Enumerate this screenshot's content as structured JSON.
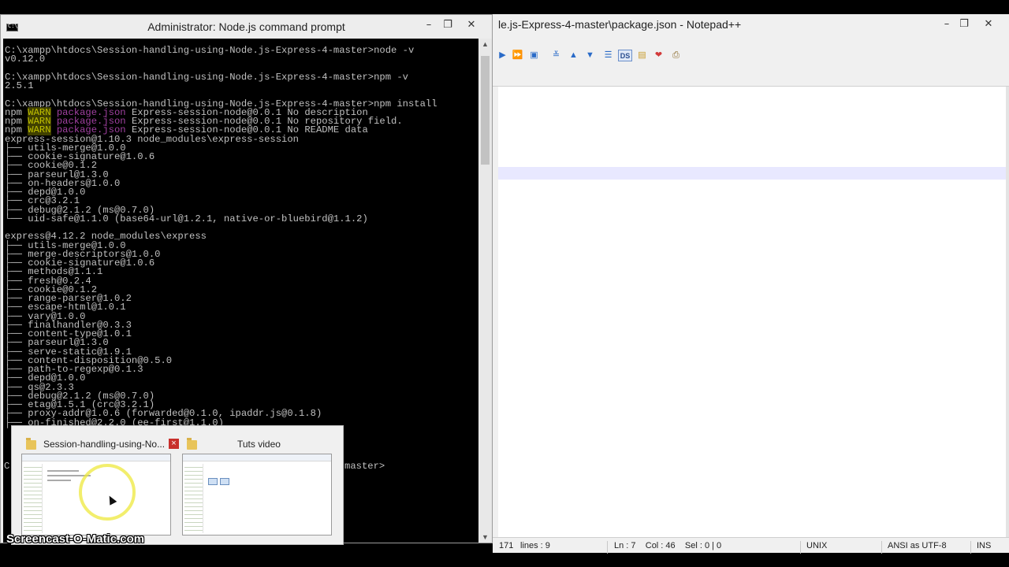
{
  "cmd": {
    "title": "Administrator: Node.js command prompt",
    "icon": "console-icon",
    "console_tail": "master>",
    "lines": [
      {
        "segments": [
          {
            "text": "C:\\xampp\\htdocs\\Session-handling-using-Node.js-Express-4-master>node -v"
          }
        ]
      },
      {
        "segments": [
          {
            "text": "v0.12.0"
          }
        ]
      },
      {
        "segments": [
          {
            "text": ""
          }
        ]
      },
      {
        "segments": [
          {
            "text": "C:\\xampp\\htdocs\\Session-handling-using-Node.js-Express-4-master>npm -v"
          }
        ]
      },
      {
        "segments": [
          {
            "text": "2.5.1"
          }
        ]
      },
      {
        "segments": [
          {
            "text": ""
          }
        ]
      },
      {
        "segments": [
          {
            "text": "C:\\xampp\\htdocs\\Session-handling-using-Node.js-Express-4-master>npm install"
          }
        ]
      },
      {
        "segments": [
          {
            "text": "npm "
          },
          {
            "text": "WARN",
            "style": "warn"
          },
          {
            "text": " "
          },
          {
            "text": "package.json",
            "style": "pkg"
          },
          {
            "text": " Express-session-node@0.0.1 No description"
          }
        ]
      },
      {
        "segments": [
          {
            "text": "npm "
          },
          {
            "text": "WARN",
            "style": "warn"
          },
          {
            "text": " "
          },
          {
            "text": "package.json",
            "style": "pkg"
          },
          {
            "text": " Express-session-node@0.0.1 No repository field."
          }
        ]
      },
      {
        "segments": [
          {
            "text": "npm "
          },
          {
            "text": "WARN",
            "style": "warn"
          },
          {
            "text": " "
          },
          {
            "text": "package.json",
            "style": "pkg"
          },
          {
            "text": " Express-session-node@0.0.1 No README data"
          }
        ]
      },
      {
        "segments": [
          {
            "text": "express-session@1.10.3 node_modules\\express-session"
          }
        ]
      },
      {
        "segments": [
          {
            "text": "├── utils-merge@1.0.0"
          }
        ]
      },
      {
        "segments": [
          {
            "text": "├── cookie-signature@1.0.6"
          }
        ]
      },
      {
        "segments": [
          {
            "text": "├── cookie@0.1.2"
          }
        ]
      },
      {
        "segments": [
          {
            "text": "├── parseurl@1.3.0"
          }
        ]
      },
      {
        "segments": [
          {
            "text": "├── on-headers@1.0.0"
          }
        ]
      },
      {
        "segments": [
          {
            "text": "├── depd@1.0.0"
          }
        ]
      },
      {
        "segments": [
          {
            "text": "├── crc@3.2.1"
          }
        ]
      },
      {
        "segments": [
          {
            "text": "├── debug@2.1.2 (ms@0.7.0)"
          }
        ]
      },
      {
        "segments": [
          {
            "text": "└── uid-safe@1.1.0 (base64-url@1.2.1, native-or-bluebird@1.1.2)"
          }
        ]
      },
      {
        "segments": [
          {
            "text": ""
          }
        ]
      },
      {
        "segments": [
          {
            "text": "express@4.12.2 node_modules\\express"
          }
        ]
      },
      {
        "segments": [
          {
            "text": "├── utils-merge@1.0.0"
          }
        ]
      },
      {
        "segments": [
          {
            "text": "├── merge-descriptors@1.0.0"
          }
        ]
      },
      {
        "segments": [
          {
            "text": "├── cookie-signature@1.0.6"
          }
        ]
      },
      {
        "segments": [
          {
            "text": "├── methods@1.1.1"
          }
        ]
      },
      {
        "segments": [
          {
            "text": "├── fresh@0.2.4"
          }
        ]
      },
      {
        "segments": [
          {
            "text": "├── cookie@0.1.2"
          }
        ]
      },
      {
        "segments": [
          {
            "text": "├── range-parser@1.0.2"
          }
        ]
      },
      {
        "segments": [
          {
            "text": "├── escape-html@1.0.1"
          }
        ]
      },
      {
        "segments": [
          {
            "text": "├── vary@1.0.0"
          }
        ]
      },
      {
        "segments": [
          {
            "text": "├── finalhandler@0.3.3"
          }
        ]
      },
      {
        "segments": [
          {
            "text": "├── content-type@1.0.1"
          }
        ]
      },
      {
        "segments": [
          {
            "text": "├── parseurl@1.3.0"
          }
        ]
      },
      {
        "segments": [
          {
            "text": "├── serve-static@1.9.1"
          }
        ]
      },
      {
        "segments": [
          {
            "text": "├── content-disposition@0.5.0"
          }
        ]
      },
      {
        "segments": [
          {
            "text": "├── path-to-regexp@0.1.3"
          }
        ]
      },
      {
        "segments": [
          {
            "text": "├── depd@1.0.0"
          }
        ]
      },
      {
        "segments": [
          {
            "text": "├── qs@2.3.3"
          }
        ]
      },
      {
        "segments": [
          {
            "text": "├── debug@2.1.2 (ms@0.7.0)"
          }
        ]
      },
      {
        "segments": [
          {
            "text": "├── etag@1.5.1 (crc@3.2.1)"
          }
        ]
      },
      {
        "segments": [
          {
            "text": "├── proxy-addr@1.0.6 (forwarded@0.1.0, ipaddr.js@0.1.8)"
          }
        ]
      },
      {
        "segments": [
          {
            "text": "├── on-finished@2.2.0 (ee-first@1.1.0)"
          }
        ]
      }
    ]
  },
  "npp": {
    "title": "le.js-Express-4-master\\package.json - Notepad++",
    "toolbar_icons": [
      "play-icon",
      "fast-forward-icon",
      "save-macro-icon",
      "wrap-icon",
      "arrow-up-icon",
      "arrow-down-icon",
      "indent-icon",
      "ds-icon",
      "note-icon",
      "heart-icon",
      "printer-icon"
    ],
    "ds_label": "DS",
    "status": {
      "length": "171",
      "lines": "lines : 9",
      "position": "Ln : 7    Col : 46    Sel : 0 | 0",
      "eol": "UNIX",
      "encoding": "ANSI as UTF-8",
      "mode": "INS"
    }
  },
  "preview": {
    "items": [
      {
        "label": "Session-handling-using-No...",
        "icon": "folder-icon",
        "close": "×"
      },
      {
        "label": "Tuts video",
        "icon": "folder-icon"
      }
    ]
  },
  "watermark": "Screencast-O-Matic.com",
  "colors": {
    "warn": "#c0c000",
    "pkg": "#a040a0",
    "console_bg": "#000000",
    "current_line": "#e8e8ff"
  }
}
